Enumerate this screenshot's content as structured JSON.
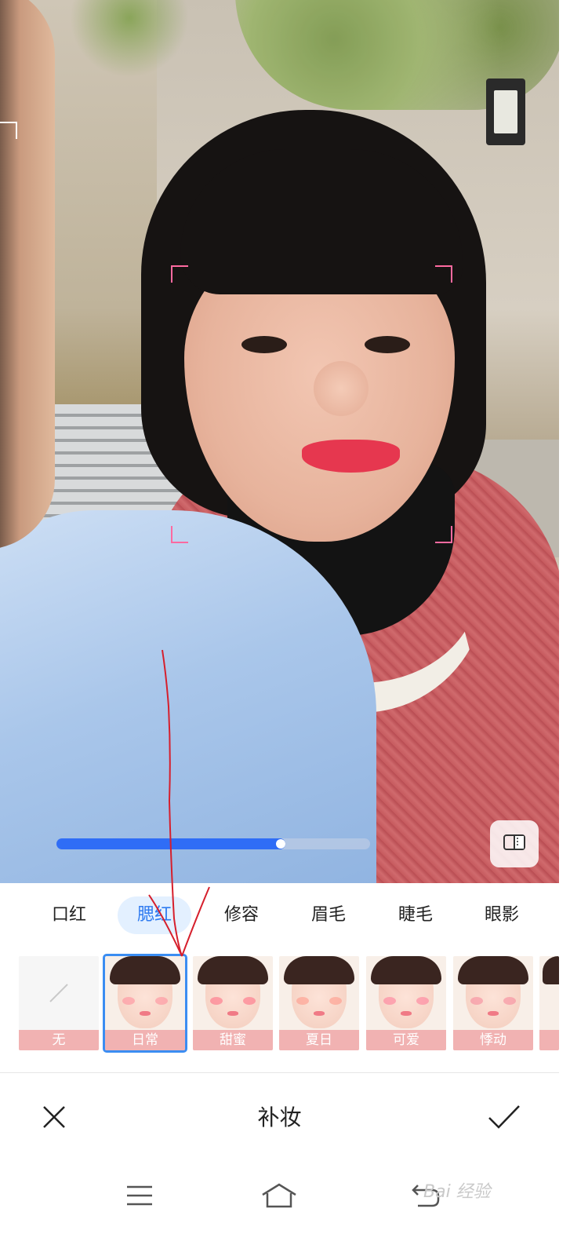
{
  "editor": {
    "intensity_value": 0.73,
    "title": "补妆",
    "compare_icon": "compare-icon",
    "cancel_icon": "close-icon",
    "confirm_icon": "check-icon"
  },
  "tabs": [
    {
      "label": "口红"
    },
    {
      "label": "腮红",
      "active": true
    },
    {
      "label": "修容"
    },
    {
      "label": "眉毛"
    },
    {
      "label": "睫毛"
    },
    {
      "label": "眼影"
    }
  ],
  "styles": [
    {
      "label": "无"
    },
    {
      "label": "日常",
      "selected": true
    },
    {
      "label": "甜蜜"
    },
    {
      "label": "夏日"
    },
    {
      "label": "可爱"
    },
    {
      "label": "悸动"
    }
  ],
  "nav": {
    "menu_icon": "menu-icon",
    "home_icon": "home-icon",
    "back_icon": "back-icon"
  },
  "watermark": "Bai 经验",
  "colors": {
    "accent": "#2f6df6",
    "tab_active_bg": "#e3f0ff",
    "tab_active_text": "#2f7bf0",
    "caption_bg": "#f1b2b2",
    "annotation": "#d61f2c"
  }
}
